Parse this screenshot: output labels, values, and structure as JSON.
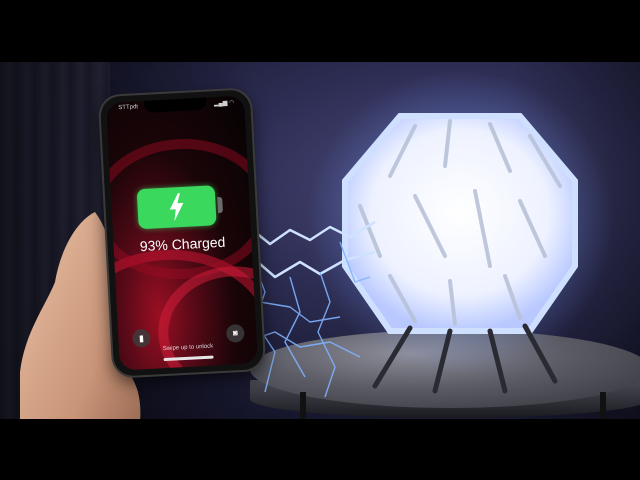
{
  "phone": {
    "carrier": "STTpdt",
    "status_icons": "▂▄▆ ◠",
    "charged_text": "93% Charged",
    "swipe_text": "Swipe up to unlock",
    "battery_level": 0.93,
    "flashlight_icon": "flashlight-icon",
    "camera_icon": "camera-icon"
  },
  "colors": {
    "battery_green": "#3ad85c",
    "lightning_blue": "#7fb2ff",
    "wallpaper_red": "#c8142f"
  }
}
